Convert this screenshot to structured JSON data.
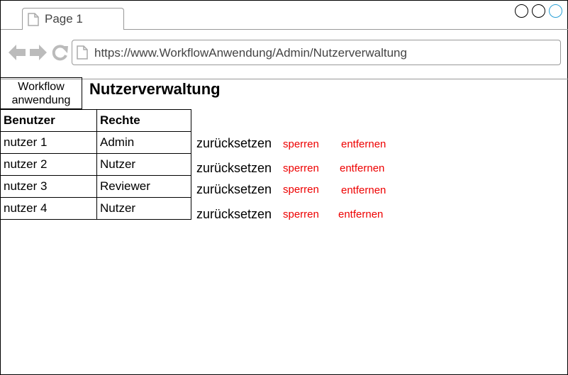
{
  "browser": {
    "tab_label": "Page 1",
    "url": "https://www.WorkflowAnwendung/Admin/Nutzerverwaltung"
  },
  "app": {
    "logo_text": "Workflow anwendung",
    "page_title": "Nutzerverwaltung"
  },
  "table": {
    "headers": [
      "Benutzer",
      "Rechte"
    ],
    "rows": [
      {
        "user": "nutzer 1",
        "role": "Admin"
      },
      {
        "user": "nutzer 2",
        "role": "Nutzer"
      },
      {
        "user": "nutzer 3",
        "role": "Reviewer"
      },
      {
        "user": "nutzer 4",
        "role": "Nutzer"
      }
    ]
  },
  "actions": {
    "reset_label": "zurücksetzen",
    "lock_label": "sperren",
    "remove_label": "entfernen"
  },
  "colors": {
    "action_link": "#ee0000",
    "window_control_accent": "#2aa0d6"
  },
  "icons": [
    "page-icon",
    "back-arrow-icon",
    "forward-arrow-icon",
    "reload-icon",
    "window-control-icon"
  ]
}
